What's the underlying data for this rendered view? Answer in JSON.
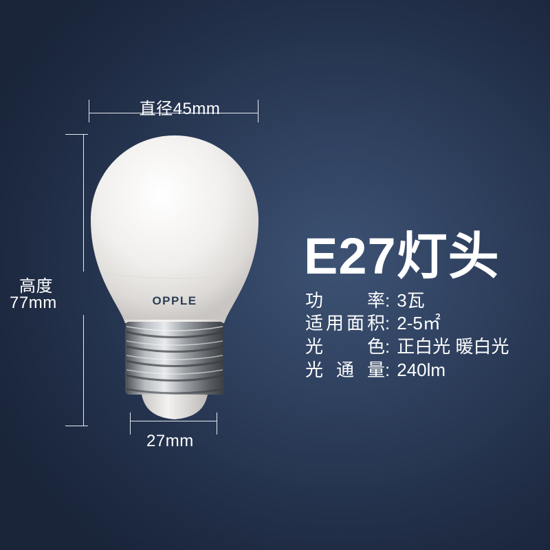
{
  "dimensions": {
    "diameter": "直径45mm",
    "height_label": "高度",
    "height_value": "77mm",
    "base_width": "27mm"
  },
  "product": {
    "brand_logo": "OPPLE",
    "title": "E27灯头"
  },
  "specs": [
    {
      "label": "功率",
      "value": "3瓦"
    },
    {
      "label": "适用面积",
      "value": "2-5㎡"
    },
    {
      "label": "光色",
      "value": "正白光 暖白光"
    },
    {
      "label": "光通量",
      "value": "240lm"
    }
  ],
  "colors": {
    "background": "#2c3d5a",
    "text": "#ffffff",
    "bulb": "#f3f1ef",
    "logo": "#2c3f56",
    "socket": "#9aa0a6"
  }
}
